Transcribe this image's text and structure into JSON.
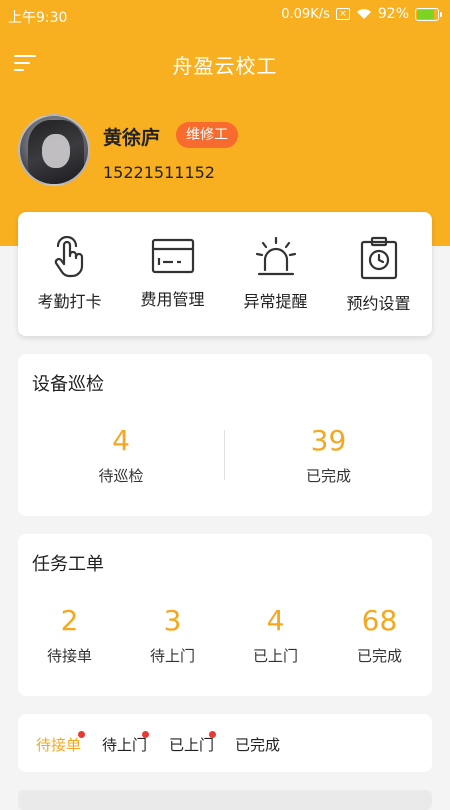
{
  "status_bar": {
    "time": "上午9:30",
    "net_speed": "0.09K/s",
    "battery_level": "92%",
    "battery_fraction": 0.92
  },
  "app": {
    "title": "舟盈云校工"
  },
  "profile": {
    "name": "黄徐庐",
    "role": "维修工",
    "phone": "15221511152"
  },
  "quick_actions": [
    {
      "label": "考勤打卡",
      "icon": "tap-hand-icon"
    },
    {
      "label": "费用管理",
      "icon": "card-icon"
    },
    {
      "label": "异常提醒",
      "icon": "alarm-light-icon"
    },
    {
      "label": "预约设置",
      "icon": "clipboard-clock-icon"
    }
  ],
  "inspection": {
    "title": "设备巡检",
    "stats": [
      {
        "value": "4",
        "label": "待巡检"
      },
      {
        "value": "39",
        "label": "已完成"
      }
    ]
  },
  "work_orders": {
    "title": "任务工单",
    "stats": [
      {
        "value": "2",
        "label": "待接单"
      },
      {
        "value": "3",
        "label": "待上门"
      },
      {
        "value": "4",
        "label": "已上门"
      },
      {
        "value": "68",
        "label": "已完成"
      }
    ]
  },
  "order_tabs": [
    {
      "label": "待接单",
      "active": true,
      "has_dot": true
    },
    {
      "label": "待上门",
      "active": false,
      "has_dot": true
    },
    {
      "label": "已上门",
      "active": false,
      "has_dot": true
    },
    {
      "label": "已完成",
      "active": false,
      "has_dot": false
    }
  ],
  "colors": {
    "brand": "#f9b020",
    "accent_number": "#f4a822",
    "badge": "#f76b2e",
    "dot": "#e53935"
  }
}
